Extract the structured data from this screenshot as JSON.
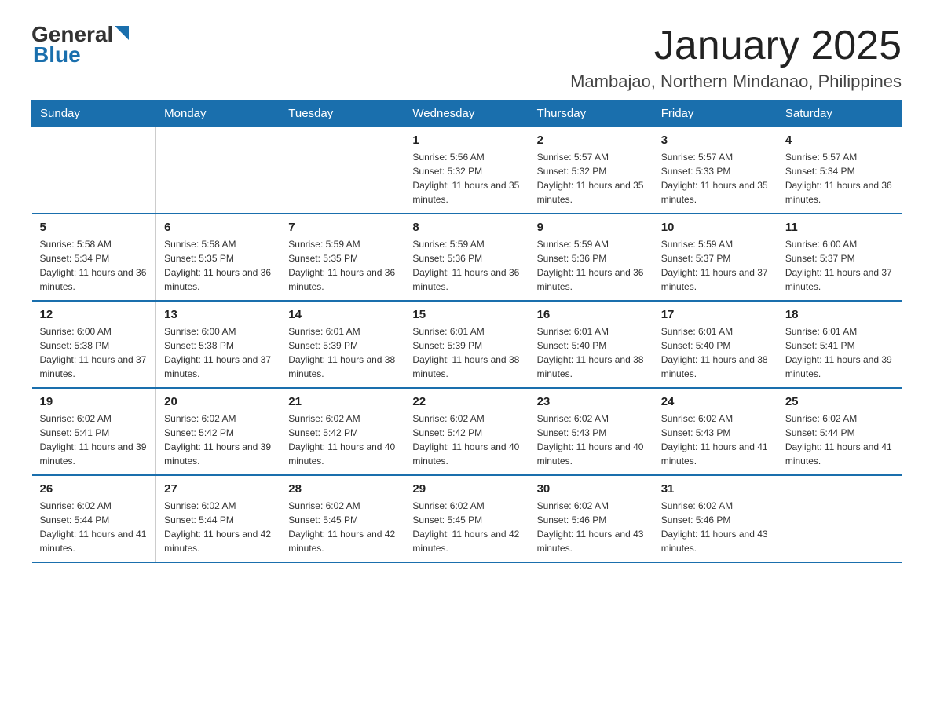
{
  "logo": {
    "text_general": "General",
    "text_blue": "Blue",
    "triangle_char": "▶"
  },
  "header": {
    "title": "January 2025",
    "subtitle": "Mambajao, Northern Mindanao, Philippines"
  },
  "days_of_week": [
    "Sunday",
    "Monday",
    "Tuesday",
    "Wednesday",
    "Thursday",
    "Friday",
    "Saturday"
  ],
  "weeks": [
    [
      {
        "day": "",
        "info": ""
      },
      {
        "day": "",
        "info": ""
      },
      {
        "day": "",
        "info": ""
      },
      {
        "day": "1",
        "info": "Sunrise: 5:56 AM\nSunset: 5:32 PM\nDaylight: 11 hours and 35 minutes."
      },
      {
        "day": "2",
        "info": "Sunrise: 5:57 AM\nSunset: 5:32 PM\nDaylight: 11 hours and 35 minutes."
      },
      {
        "day": "3",
        "info": "Sunrise: 5:57 AM\nSunset: 5:33 PM\nDaylight: 11 hours and 35 minutes."
      },
      {
        "day": "4",
        "info": "Sunrise: 5:57 AM\nSunset: 5:34 PM\nDaylight: 11 hours and 36 minutes."
      }
    ],
    [
      {
        "day": "5",
        "info": "Sunrise: 5:58 AM\nSunset: 5:34 PM\nDaylight: 11 hours and 36 minutes."
      },
      {
        "day": "6",
        "info": "Sunrise: 5:58 AM\nSunset: 5:35 PM\nDaylight: 11 hours and 36 minutes."
      },
      {
        "day": "7",
        "info": "Sunrise: 5:59 AM\nSunset: 5:35 PM\nDaylight: 11 hours and 36 minutes."
      },
      {
        "day": "8",
        "info": "Sunrise: 5:59 AM\nSunset: 5:36 PM\nDaylight: 11 hours and 36 minutes."
      },
      {
        "day": "9",
        "info": "Sunrise: 5:59 AM\nSunset: 5:36 PM\nDaylight: 11 hours and 36 minutes."
      },
      {
        "day": "10",
        "info": "Sunrise: 5:59 AM\nSunset: 5:37 PM\nDaylight: 11 hours and 37 minutes."
      },
      {
        "day": "11",
        "info": "Sunrise: 6:00 AM\nSunset: 5:37 PM\nDaylight: 11 hours and 37 minutes."
      }
    ],
    [
      {
        "day": "12",
        "info": "Sunrise: 6:00 AM\nSunset: 5:38 PM\nDaylight: 11 hours and 37 minutes."
      },
      {
        "day": "13",
        "info": "Sunrise: 6:00 AM\nSunset: 5:38 PM\nDaylight: 11 hours and 37 minutes."
      },
      {
        "day": "14",
        "info": "Sunrise: 6:01 AM\nSunset: 5:39 PM\nDaylight: 11 hours and 38 minutes."
      },
      {
        "day": "15",
        "info": "Sunrise: 6:01 AM\nSunset: 5:39 PM\nDaylight: 11 hours and 38 minutes."
      },
      {
        "day": "16",
        "info": "Sunrise: 6:01 AM\nSunset: 5:40 PM\nDaylight: 11 hours and 38 minutes."
      },
      {
        "day": "17",
        "info": "Sunrise: 6:01 AM\nSunset: 5:40 PM\nDaylight: 11 hours and 38 minutes."
      },
      {
        "day": "18",
        "info": "Sunrise: 6:01 AM\nSunset: 5:41 PM\nDaylight: 11 hours and 39 minutes."
      }
    ],
    [
      {
        "day": "19",
        "info": "Sunrise: 6:02 AM\nSunset: 5:41 PM\nDaylight: 11 hours and 39 minutes."
      },
      {
        "day": "20",
        "info": "Sunrise: 6:02 AM\nSunset: 5:42 PM\nDaylight: 11 hours and 39 minutes."
      },
      {
        "day": "21",
        "info": "Sunrise: 6:02 AM\nSunset: 5:42 PM\nDaylight: 11 hours and 40 minutes."
      },
      {
        "day": "22",
        "info": "Sunrise: 6:02 AM\nSunset: 5:42 PM\nDaylight: 11 hours and 40 minutes."
      },
      {
        "day": "23",
        "info": "Sunrise: 6:02 AM\nSunset: 5:43 PM\nDaylight: 11 hours and 40 minutes."
      },
      {
        "day": "24",
        "info": "Sunrise: 6:02 AM\nSunset: 5:43 PM\nDaylight: 11 hours and 41 minutes."
      },
      {
        "day": "25",
        "info": "Sunrise: 6:02 AM\nSunset: 5:44 PM\nDaylight: 11 hours and 41 minutes."
      }
    ],
    [
      {
        "day": "26",
        "info": "Sunrise: 6:02 AM\nSunset: 5:44 PM\nDaylight: 11 hours and 41 minutes."
      },
      {
        "day": "27",
        "info": "Sunrise: 6:02 AM\nSunset: 5:44 PM\nDaylight: 11 hours and 42 minutes."
      },
      {
        "day": "28",
        "info": "Sunrise: 6:02 AM\nSunset: 5:45 PM\nDaylight: 11 hours and 42 minutes."
      },
      {
        "day": "29",
        "info": "Sunrise: 6:02 AM\nSunset: 5:45 PM\nDaylight: 11 hours and 42 minutes."
      },
      {
        "day": "30",
        "info": "Sunrise: 6:02 AM\nSunset: 5:46 PM\nDaylight: 11 hours and 43 minutes."
      },
      {
        "day": "31",
        "info": "Sunrise: 6:02 AM\nSunset: 5:46 PM\nDaylight: 11 hours and 43 minutes."
      },
      {
        "day": "",
        "info": ""
      }
    ]
  ]
}
